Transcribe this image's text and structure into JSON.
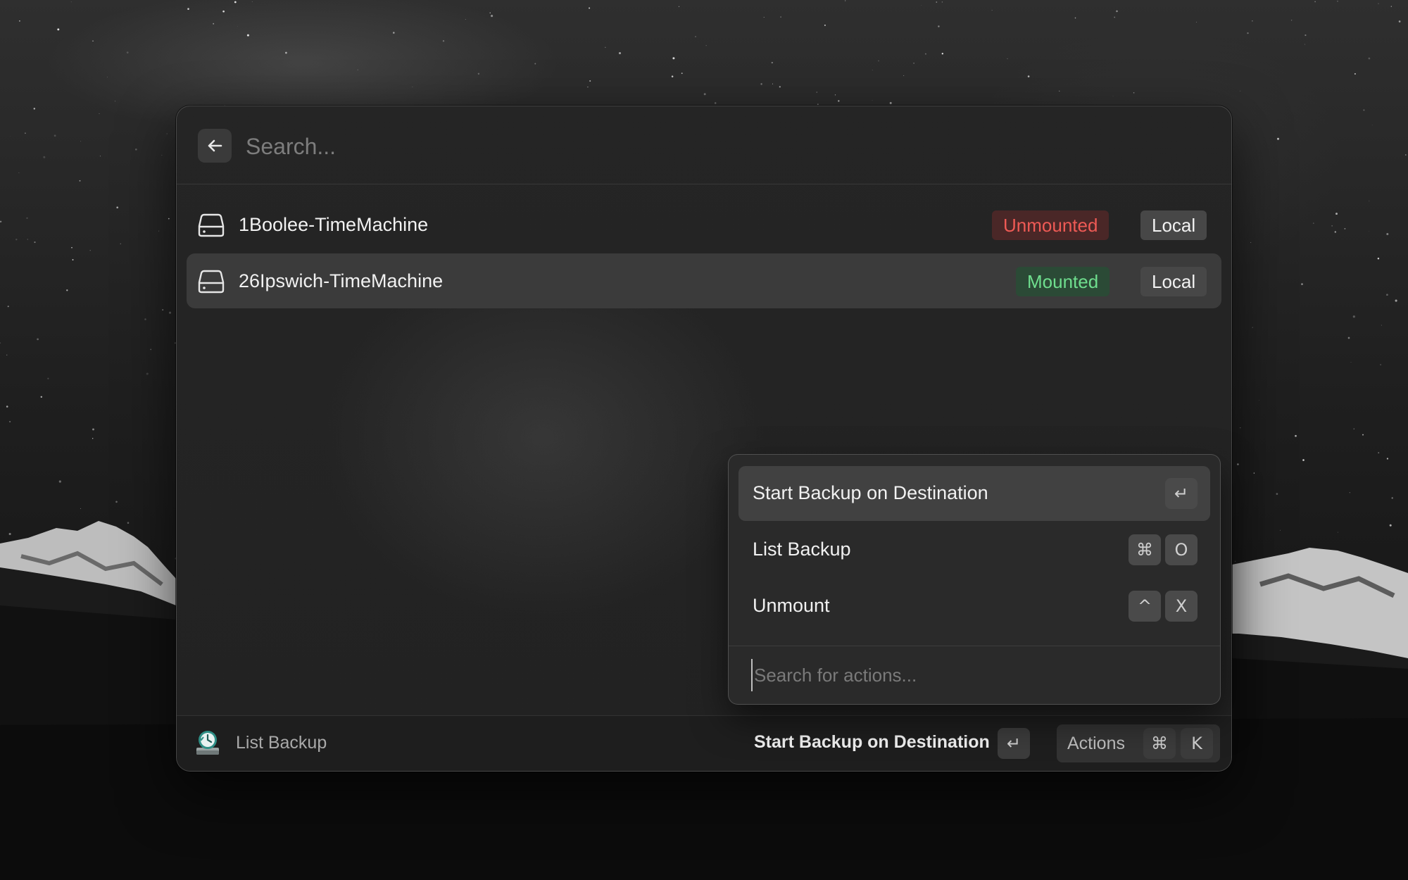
{
  "search": {
    "placeholder": "Search..."
  },
  "drives": [
    {
      "name": "1Boolee-TimeMachine",
      "status": "Unmounted",
      "type": "Local"
    },
    {
      "name": "26Ipswich-TimeMachine",
      "status": "Mounted",
      "type": "Local"
    }
  ],
  "actions_panel": {
    "items": [
      {
        "label": "Start Backup on Destination",
        "keys": [
          "↵"
        ]
      },
      {
        "label": "List Backup",
        "keys": [
          "⌘",
          "O"
        ]
      },
      {
        "label": "Unmount",
        "keys": [
          "^",
          "X"
        ]
      }
    ],
    "search_placeholder": "Search for actions..."
  },
  "footer": {
    "breadcrumb": "List Backup",
    "primary_action": "Start Backup on Destination",
    "primary_key": "↵",
    "actions_label": "Actions",
    "actions_keys": [
      "⌘",
      "K"
    ]
  },
  "colors": {
    "unmounted": "#ee5a55",
    "mounted": "#6fde8e",
    "accent_icon": "#4fb3a6"
  },
  "icons": {
    "back": "arrow-left-icon",
    "drive": "hard-drive-icon",
    "app": "time-machine-icon"
  }
}
